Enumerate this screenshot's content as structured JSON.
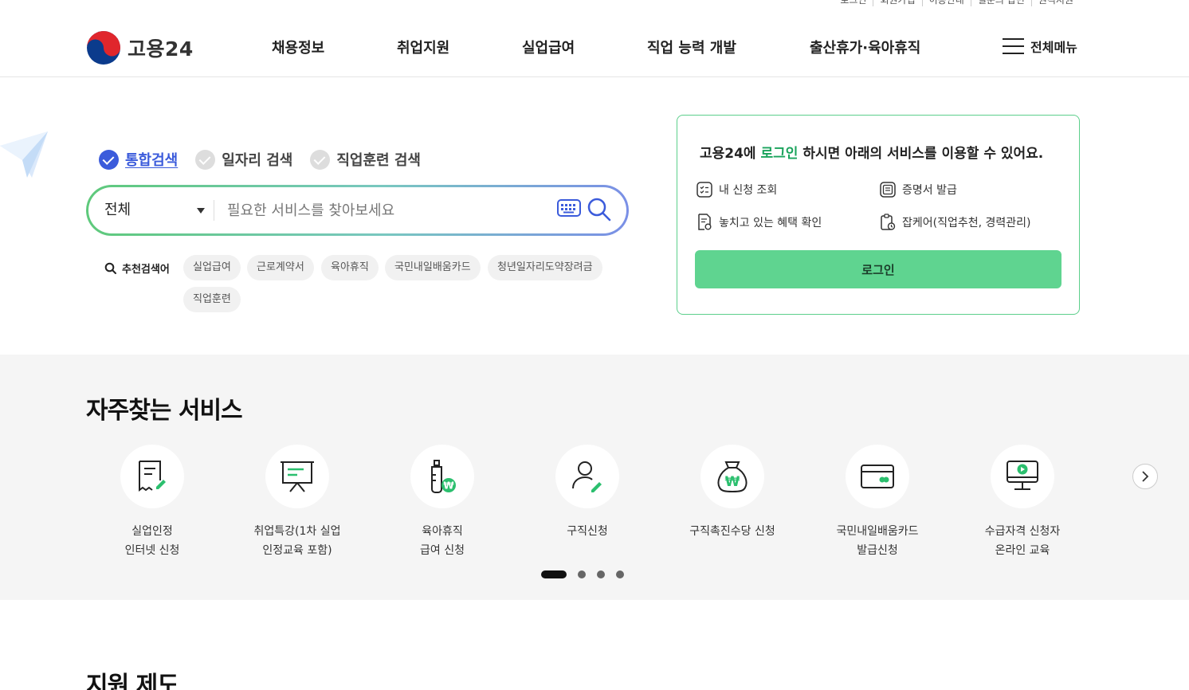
{
  "util_links": [
    "로그인",
    "회원가입",
    "이용안내",
    "질문의 답변",
    "원격지원"
  ],
  "logo": {
    "text": "고용24"
  },
  "gnb": [
    {
      "label": "채용정보"
    },
    {
      "label": "취업지원"
    },
    {
      "label": "실업급여"
    },
    {
      "label": "직업 능력 개발"
    },
    {
      "label": "출산휴가·육아휴직"
    }
  ],
  "allmenu": {
    "label": "전체메뉴"
  },
  "search": {
    "tabs": [
      {
        "label": "통합검색",
        "active": true
      },
      {
        "label": "일자리 검색",
        "active": false
      },
      {
        "label": "직업훈련 검색",
        "active": false
      }
    ],
    "category": "전체",
    "placeholder": "필요한 서비스를 찾아보세요",
    "recommend_title": "추천검색어",
    "keywords": [
      "실업급여",
      "근로계약서",
      "육아휴직",
      "국민내일배움카드",
      "청년일자리도약장려금",
      "직업훈련"
    ]
  },
  "login": {
    "title_pre": "고용24에 ",
    "title_link": "로그인",
    "title_post": " 하시면 아래의 서비스를 이용할 수 있어요.",
    "items": [
      "내 신청 조회",
      "증명서 발급",
      "놓치고 있는 혜택 확인",
      "잡케어(직업추천, 경력관리)"
    ],
    "button": "로그인"
  },
  "frequent": {
    "title": "자주찾는 서비스",
    "services": [
      {
        "label": "실업인정\n인터넷 신청",
        "icon": "document-edit-icon"
      },
      {
        "label": "취업특강(1차 실업\n인정교육 포함)",
        "icon": "presentation-board-icon"
      },
      {
        "label": "육아휴직\n급여 신청",
        "icon": "baby-bottle-won-icon"
      },
      {
        "label": "구직신청",
        "icon": "person-edit-icon"
      },
      {
        "label": "구직촉진수당 신청",
        "icon": "money-bag-won-icon"
      },
      {
        "label": "국민내일배움카드\n발급신청",
        "icon": "card-icon"
      },
      {
        "label": "수급자격 신청자\n온라인 교육",
        "icon": "online-monitor-icon"
      }
    ],
    "page_count": 4,
    "active_page": 1
  },
  "support": {
    "title": "지원 제도"
  },
  "colors": {
    "accent_green": "#5fd490",
    "link_blue": "#3b5bdb",
    "border_green": "#5ccf8b"
  }
}
